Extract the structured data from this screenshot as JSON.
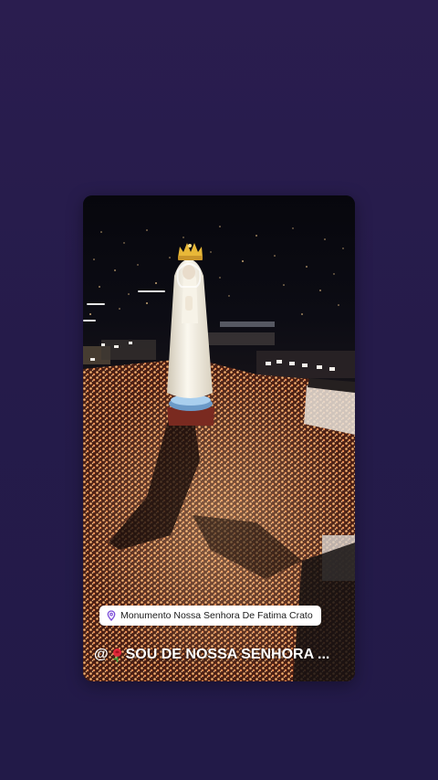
{
  "story": {
    "location_label": "Monumento Nossa Senhora De Fatima Crato",
    "mention_prefix": "@",
    "mention_text": "SOU DE NOSSA SENHORA ...",
    "image_icon": "aerial-photo-statue-candles",
    "location_icon": "location-pin-icon",
    "mention_icon": "rose-emoji-icon"
  },
  "colors": {
    "background": "#251b4a",
    "sticker_bg": "#ffffff",
    "candle_glow": "#f0a05a",
    "statue": "#f1ede2",
    "crown": "#e8b838"
  }
}
